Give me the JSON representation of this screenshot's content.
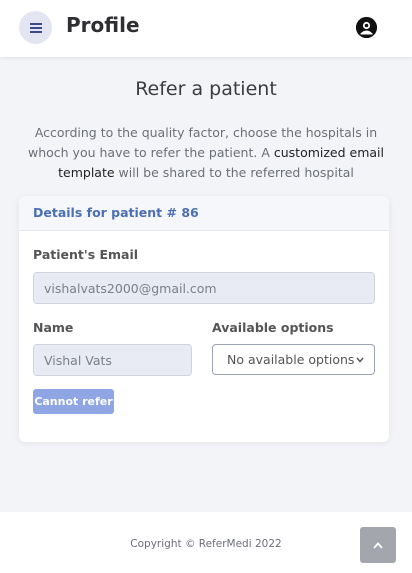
{
  "header": {
    "title": "Profile",
    "menu_icon": "hamburger-menu-icon",
    "avatar_icon": "user-avatar-icon"
  },
  "main": {
    "heading": "Refer a patient",
    "description_part1": "According to the quality factor, choose the hospitals in whoch you have to refer the patient. A ",
    "description_highlight": "customized email template",
    "description_part2": " will be shared to the referred hospital"
  },
  "card": {
    "header": "Details for patient # 86",
    "email_label": "Patient's Email",
    "email_value": "vishalvats2000@gmail.com",
    "name_label": "Name",
    "name_value": "Vishal Vats",
    "options_label": "Available options",
    "options_selected": "No available options",
    "refer_button": "Cannot refer"
  },
  "footer": {
    "copyright": "Copyright © ReferMedi 2022",
    "scroll_top_icon": "chevron-up-icon"
  },
  "colors": {
    "accent": "#4a6fb3",
    "button": "#8fa5e4",
    "background": "#f3f4f8"
  }
}
